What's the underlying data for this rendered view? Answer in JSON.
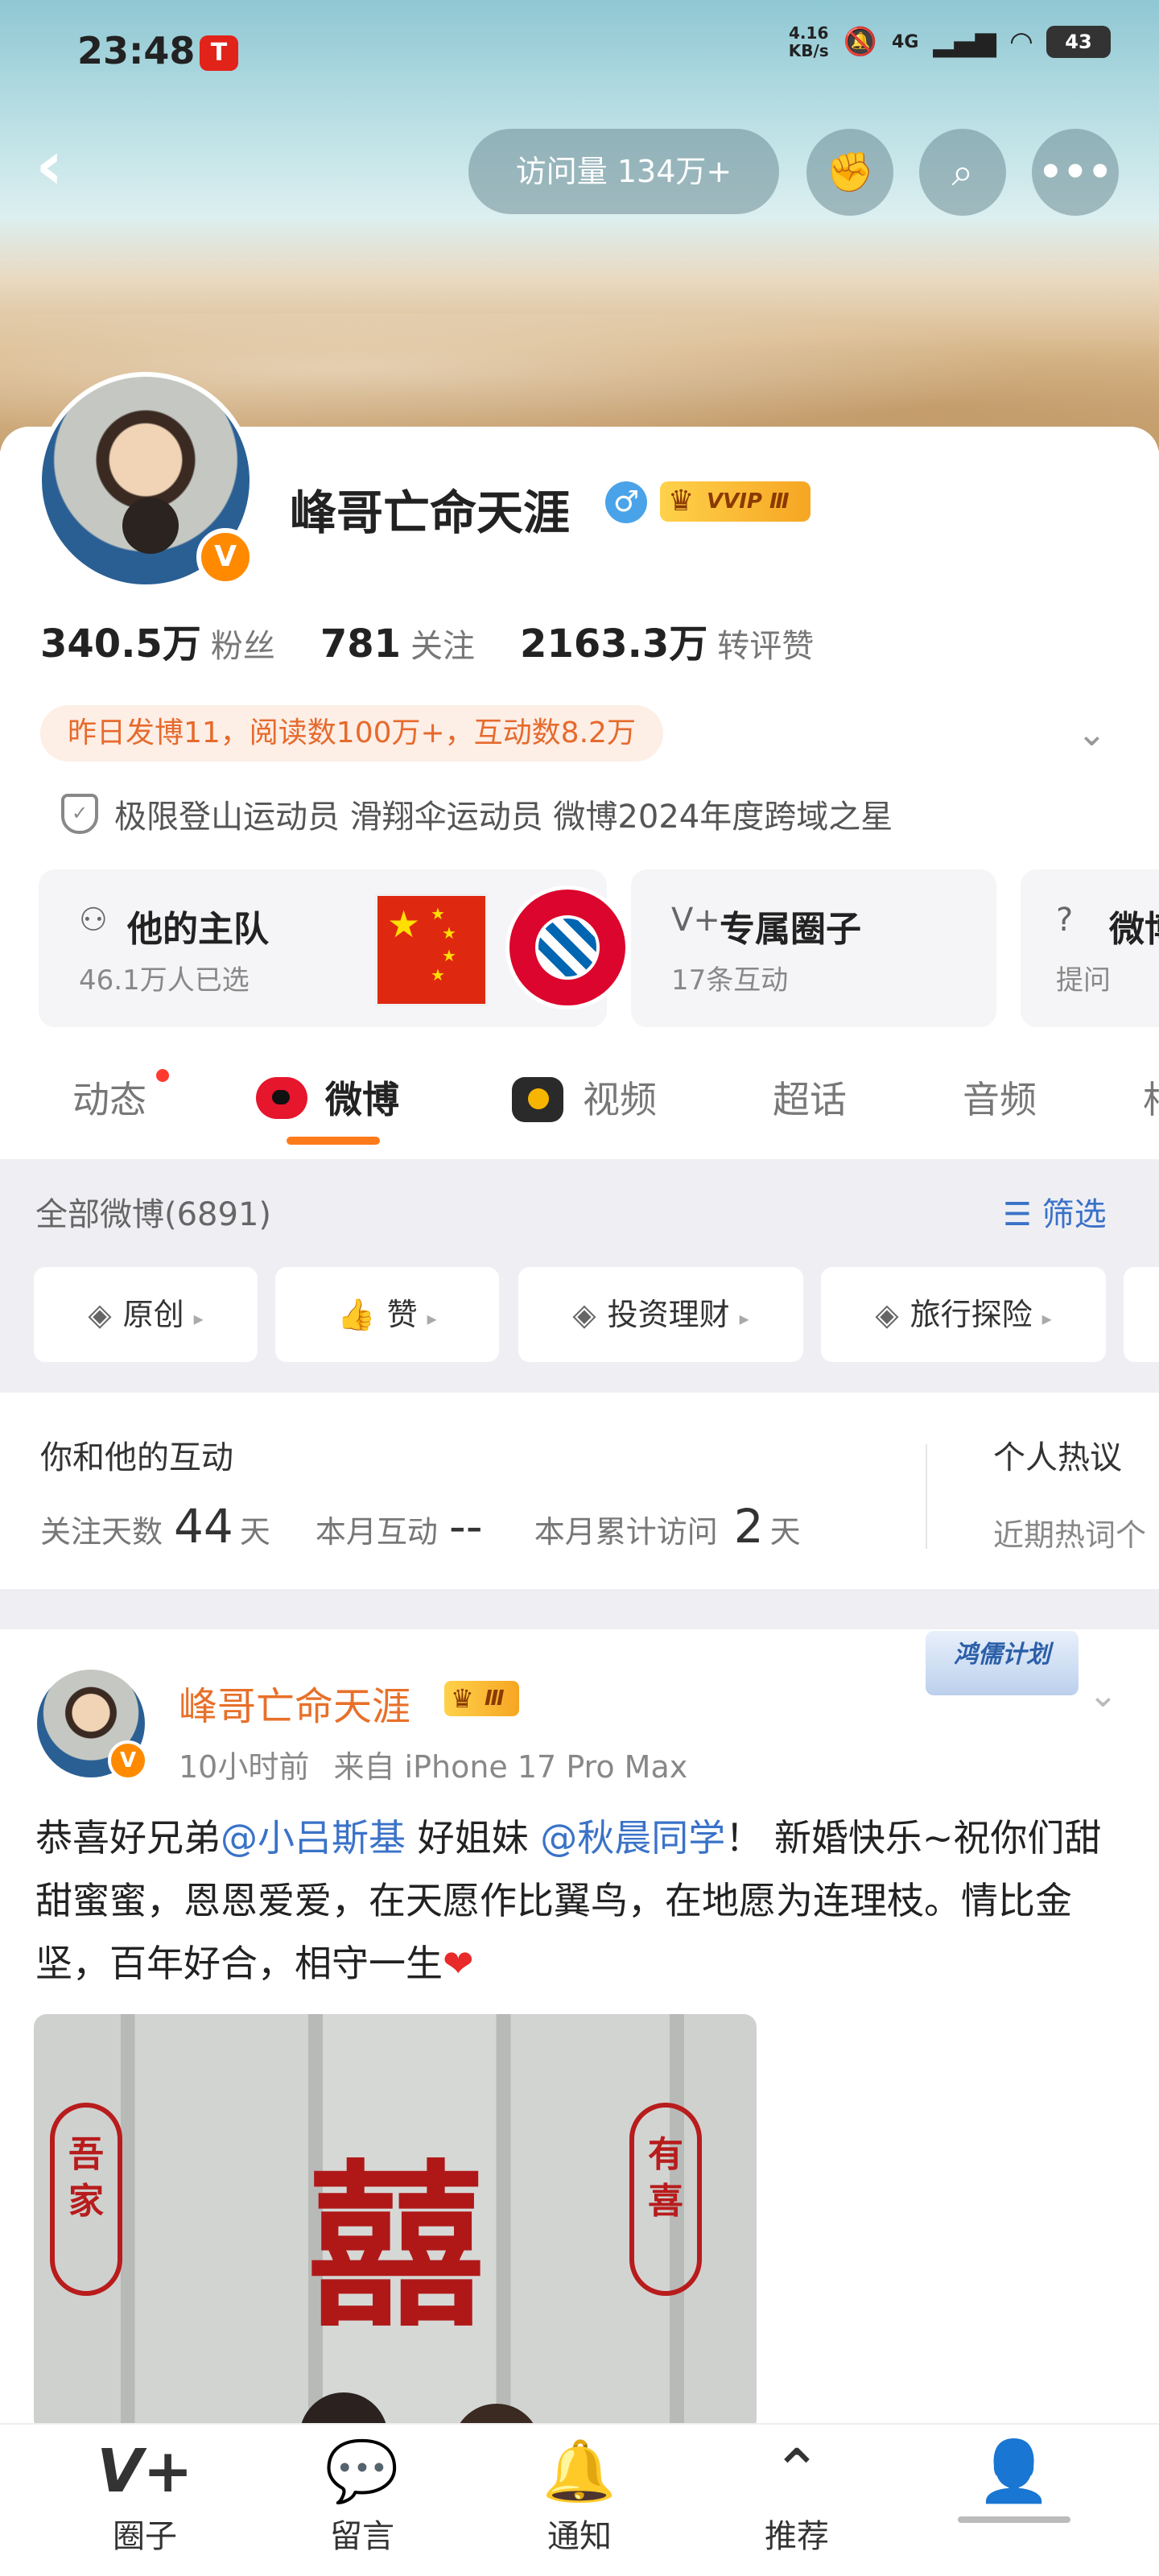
{
  "status_bar": {
    "time": "23:48",
    "app_badge": "T",
    "net_speed_value": "4.16",
    "net_speed_unit": "KB/s",
    "network": "4G",
    "battery": "43"
  },
  "header": {
    "visits": "访问量 134万+",
    "icons": [
      "back-icon",
      "fist-icon",
      "search-icon",
      "more-icon"
    ]
  },
  "profile": {
    "name": "峰哥亡命天涯",
    "gender_symbol": "♂",
    "vip_label": "VVIP Ⅲ",
    "verified_mark": "V",
    "stats": [
      {
        "value": "340.5万",
        "label": "粉丝"
      },
      {
        "value": "781",
        "label": "关注"
      },
      {
        "value": "2163.3万",
        "label": "转评赞"
      }
    ],
    "yesterday": "昨日发博11，阅读数100万+，互动数8.2万",
    "tags": "极限登山运动员 滑翔伞运动员 微博2024年度跨域之星"
  },
  "feature_cards": [
    {
      "title": "他的主队",
      "sub": "46.1万人已选"
    },
    {
      "title": "专属圈子",
      "sub": "17条互动"
    },
    {
      "title": "微博",
      "sub": "提问"
    }
  ],
  "tabs": [
    {
      "label": "动态",
      "dot": true
    },
    {
      "label": "微博",
      "active": true
    },
    {
      "label": "视频"
    },
    {
      "label": "超话"
    },
    {
      "label": "音频"
    },
    {
      "label": "相"
    }
  ],
  "feed_header": {
    "all": "全部微博(6891)",
    "filter": "筛选",
    "chips": [
      "原创",
      "赞",
      "投资理财",
      "旅行探险"
    ]
  },
  "interaction": {
    "title": "你和他的互动",
    "follow_days_label": "关注天数",
    "follow_days_value": "44",
    "days_unit": "天",
    "month_inter_label": "本月互动",
    "month_inter_value": "--",
    "month_visit_label": "本月累计访问",
    "month_visit_value": "2",
    "hot_title": "个人热议",
    "hot_sub": "近期热词个"
  },
  "post": {
    "author": "峰哥亡命天涯",
    "vip_label": "Ⅲ",
    "verified_mark": "V",
    "badge": "鸿儒计划",
    "time": "10小时前",
    "source": "来自 iPhone 17 Pro Max",
    "text_part1": "恭喜好兄弟",
    "mention1": "@小吕斯基",
    "text_part2": " 好姐妹 ",
    "mention2": "@秋晨同学",
    "text_part3": "！ 新婚快乐~祝你们甜甜蜜蜜，恩恩爱爱，在天愿作比翼鸟，在地愿为连理枝。情比金坚，百年好合，相守一生",
    "heart": "❤",
    "photo_left_text": "吾家",
    "photo_center_text": "囍",
    "photo_right_text": "有喜"
  },
  "bottom_nav": [
    {
      "label": "圈子",
      "icon": "circle-v-icon"
    },
    {
      "label": "留言",
      "icon": "message-icon"
    },
    {
      "label": "通知",
      "icon": "bell-icon"
    },
    {
      "label": "推荐",
      "icon": "up-arrow-icon"
    },
    {
      "label": "",
      "icon": "user-check-icon"
    }
  ]
}
